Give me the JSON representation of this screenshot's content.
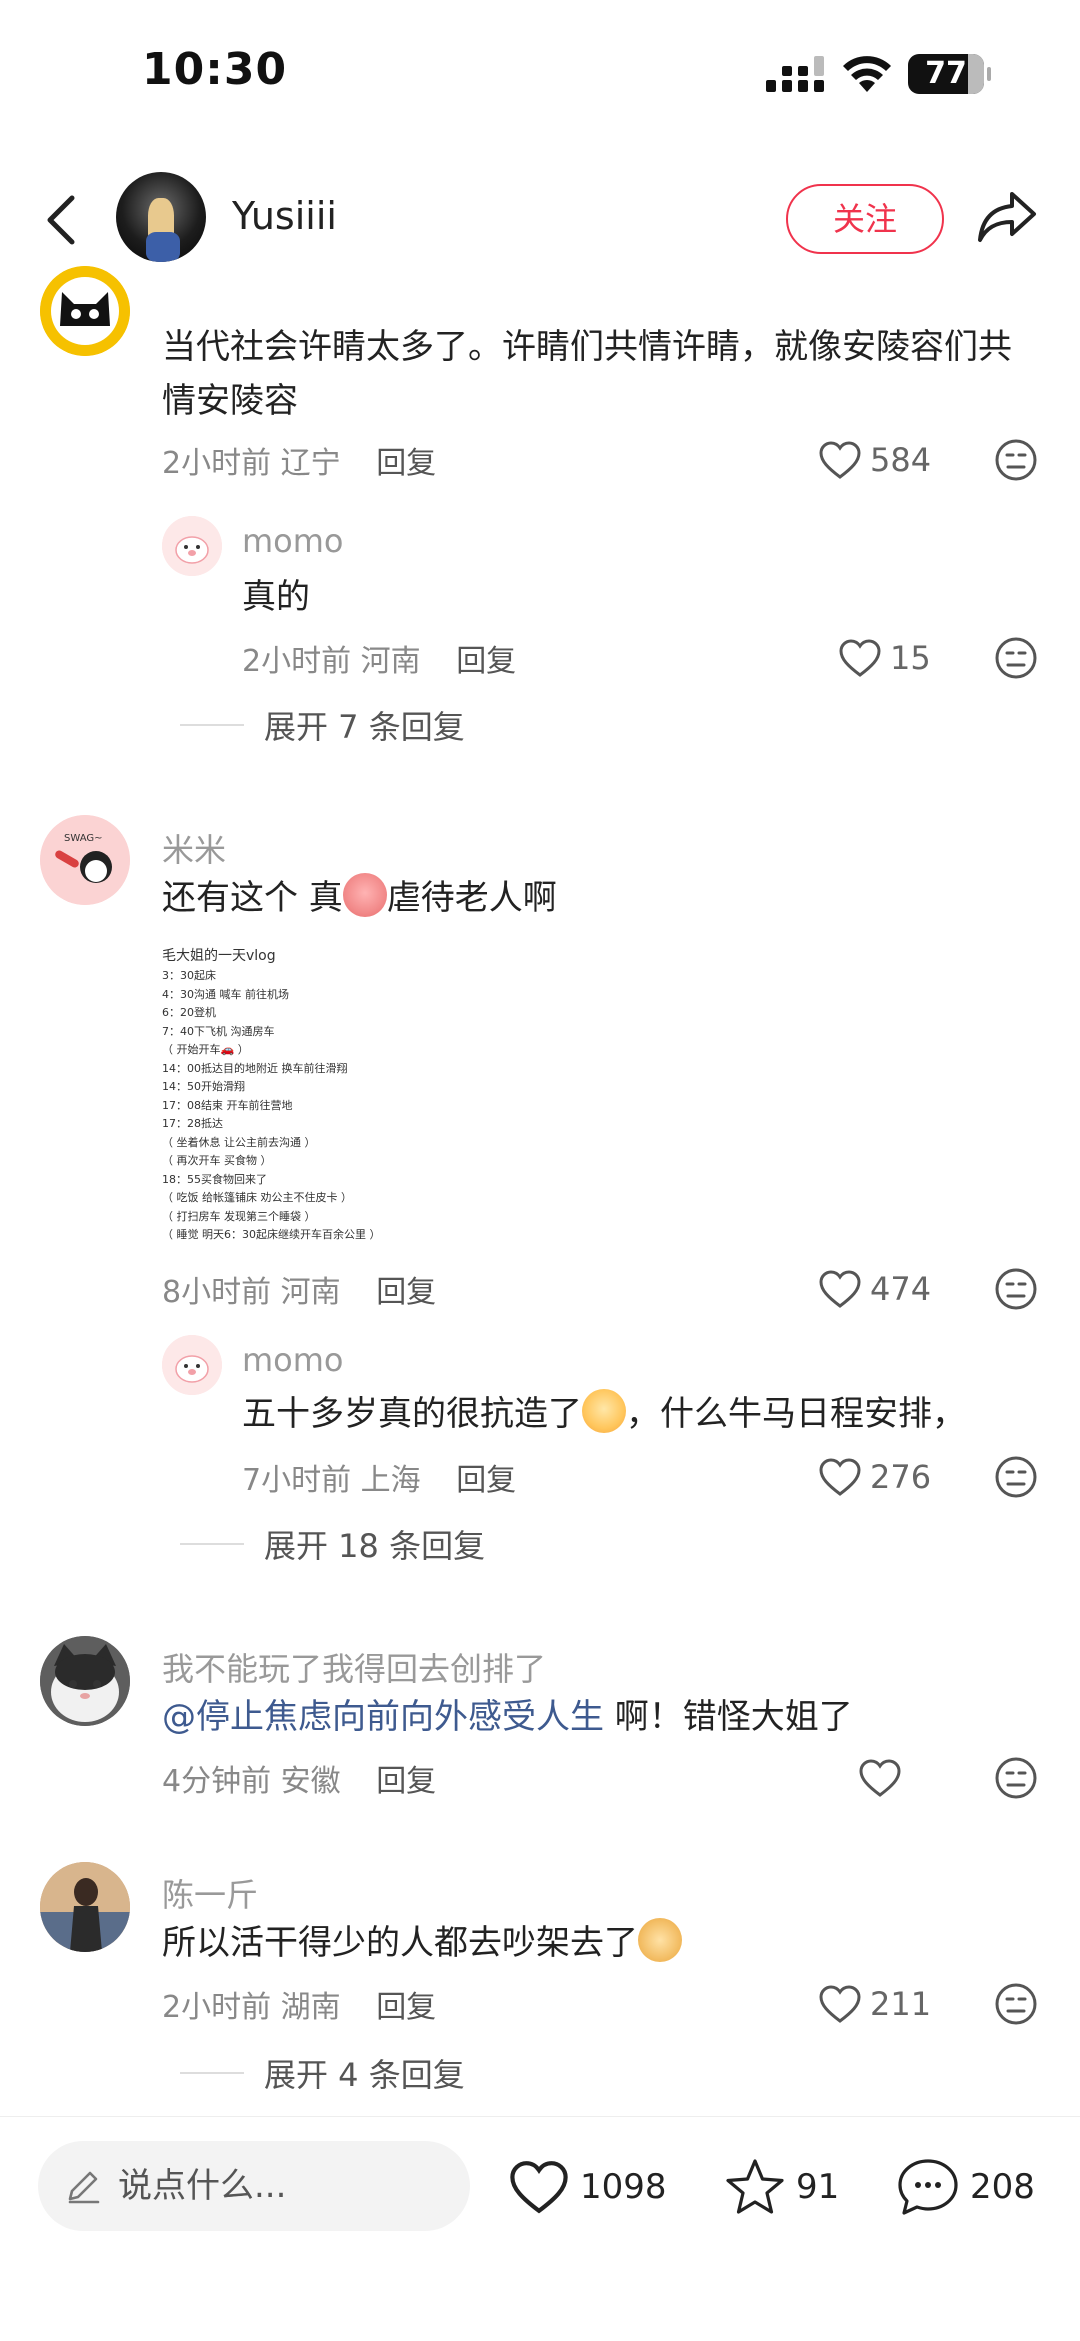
{
  "status_bar": {
    "time": "10:30",
    "battery": "77"
  },
  "header": {
    "username": "Yusiiii",
    "follow_label": "关注"
  },
  "comments": [
    {
      "username": "",
      "text": "当代社会许睛太多了。许睛们共情许睛，就像安陵容们共情安陵容",
      "time": "2小时前",
      "location": "辽宁",
      "reply_label": "回复",
      "likes": "584",
      "replies": [
        {
          "username": "momo",
          "text": "真的",
          "time": "2小时前",
          "location": "河南",
          "reply_label": "回复",
          "likes": "15"
        }
      ],
      "expand_label": "展开 7 条回复"
    },
    {
      "username": "米米",
      "text_before": "还有这个 真",
      "text_after": "虐待老人啊",
      "image": {
        "title": "毛大姐的一天vlog",
        "lines": [
          "3：30起床",
          "4：30沟通 喊车 前往机场",
          "6：20登机",
          "7：40下飞机 沟通房车",
          "（ 开始开车🚗 ）",
          "14：00抵达目的地附近 换车前往滑翔",
          "14：50开始滑翔",
          "17：08结束 开车前往营地",
          "17：28抵达",
          "（ 坐着休息 让公主前去沟通 ）",
          "（ 再次开车 买食物 ）",
          "18：55买食物回来了",
          "（ 吃饭 给帐篷铺床 劝公主不住皮卡 ）",
          "（ 打扫房车 发现第三个睡袋 ）",
          "（ 睡觉 明天6：30起床继续开车百余公里 ）"
        ]
      },
      "time": "8小时前",
      "location": "河南",
      "reply_label": "回复",
      "likes": "474",
      "replies": [
        {
          "username": "momo",
          "text_before": "五十多岁真的很抗造了",
          "text_after": "，什么牛马日程安排，",
          "time": "7小时前",
          "location": "上海",
          "reply_label": "回复",
          "likes": "276"
        }
      ],
      "expand_label": "展开 18 条回复"
    },
    {
      "username": "我不能玩了我得回去创排了",
      "mention": "@停止焦虑向前向外感受人生",
      "text": " 啊！错怪大姐了",
      "time": "4分钟前",
      "location": "安徽",
      "reply_label": "回复",
      "likes": ""
    },
    {
      "username": "陈一斤",
      "text": "所以活干得少的人都去吵架去了",
      "time": "2小时前",
      "location": "湖南",
      "reply_label": "回复",
      "likes": "211",
      "expand_label": "展开 4 条回复"
    }
  ],
  "bottom_bar": {
    "input_placeholder": "说点什么...",
    "likes": "1098",
    "stars": "91",
    "comments": "208"
  },
  "colors": {
    "accent": "#f0334c",
    "mention": "#3e5a8f"
  },
  "icons": [
    "back-arrow-icon",
    "share-icon",
    "heart-icon",
    "dislike-face-icon",
    "pencil-icon",
    "star-icon",
    "comment-bubble-icon"
  ]
}
